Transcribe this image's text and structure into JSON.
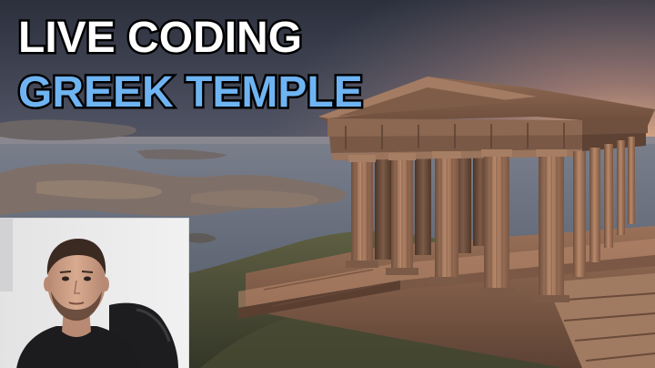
{
  "thumbnail": {
    "title_line_1": "LIVE CODING",
    "title_line_2": "GREEK TEMPLE",
    "title_color_primary": "#ffffff",
    "title_color_accent": "#6fb4f2",
    "title_outline_color": "#000000"
  },
  "scene": {
    "subject": "greek-temple",
    "sky_colors": [
      "#2f3340",
      "#5b5c6a",
      "#a88a88",
      "#f0b489"
    ],
    "sea_color": "#6f7684",
    "stone_color": "#a77a5c"
  },
  "webcam": {
    "subject": "presenter",
    "background_color": "#e9e9ea"
  }
}
